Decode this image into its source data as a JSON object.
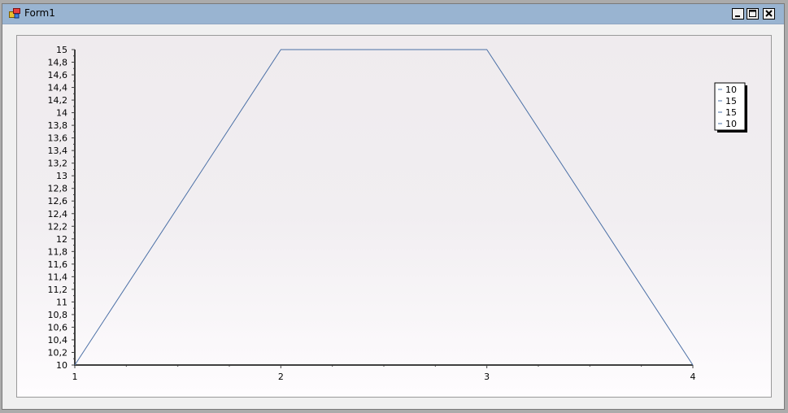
{
  "window": {
    "title": "Form1",
    "controls": {
      "minimize": "minimize",
      "maximize": "maximize",
      "close": "close"
    }
  },
  "colors": {
    "titlebar": "#99b4d1",
    "series": "#4a6fa5",
    "axis": "#404040"
  },
  "chart_data": {
    "type": "line",
    "x": [
      1,
      2,
      3,
      4
    ],
    "series": [
      {
        "values": [
          10,
          15,
          15,
          10
        ]
      }
    ],
    "xticks": [
      "1",
      "2",
      "3",
      "4"
    ],
    "yticks": [
      "10",
      "10,2",
      "10,4",
      "10,6",
      "10,8",
      "11",
      "11,2",
      "11,4",
      "11,6",
      "11,8",
      "12",
      "12,2",
      "12,4",
      "12,6",
      "12,8",
      "13",
      "13,2",
      "13,4",
      "13,6",
      "13,8",
      "14",
      "14,2",
      "14,4",
      "14,6",
      "14,8",
      "15"
    ],
    "xlim": [
      1,
      4
    ],
    "ylim": [
      10,
      15
    ],
    "legend": {
      "placement": "top-right",
      "entries": [
        "10",
        "15",
        "15",
        "10"
      ]
    },
    "grid": false
  }
}
